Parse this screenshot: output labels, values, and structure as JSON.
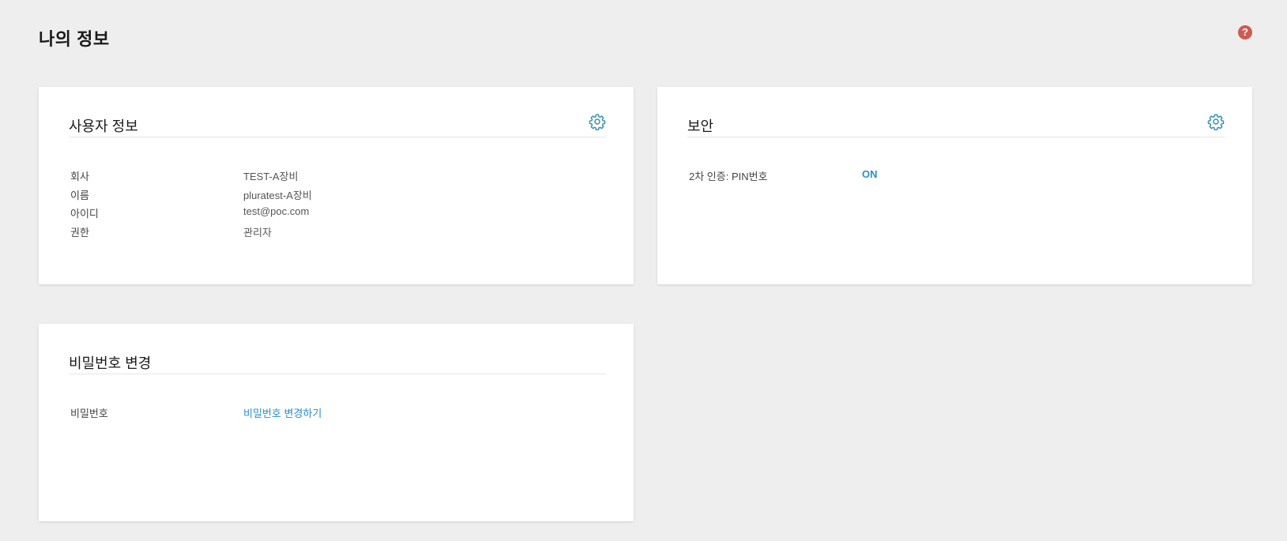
{
  "page": {
    "title": "나의 정보",
    "help_icon_glyph": "?"
  },
  "user_info": {
    "title": "사용자 정보",
    "settings_icon": "gear-icon",
    "rows": [
      {
        "label": "회사",
        "value": "TEST-A장비"
      },
      {
        "label": "이름",
        "value": "pluratest-A장비"
      },
      {
        "label": "아이디",
        "value": "test@poc.com"
      },
      {
        "label": "권한",
        "value": "관리자"
      }
    ]
  },
  "security": {
    "title": "보안",
    "settings_icon": "gear-icon",
    "rows": [
      {
        "label": "2차 인증: PIN번호",
        "value": "ON"
      }
    ]
  },
  "password": {
    "title": "비밀번호 변경",
    "rows": [
      {
        "label": "비밀번호",
        "value": "비밀번호 변경하기"
      }
    ]
  },
  "colors": {
    "background": "#eeeeee",
    "card": "#ffffff",
    "accent": "#2d8ec6",
    "help_icon": "#cd5c53",
    "gear_icon": "#3a8fa8"
  }
}
